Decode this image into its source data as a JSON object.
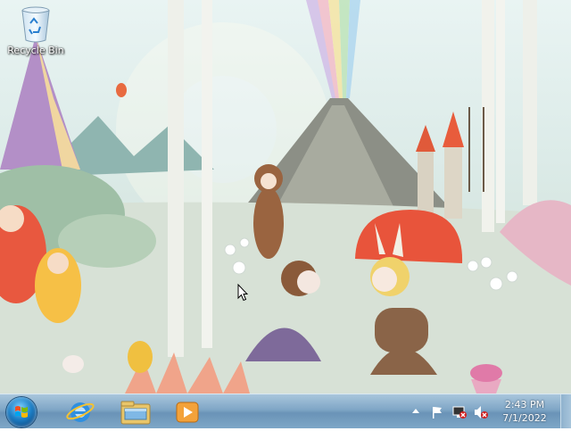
{
  "desktop": {
    "icons": [
      {
        "name": "recycle-bin",
        "label": "Recycle Bin"
      }
    ]
  },
  "taskbar": {
    "pinned": [
      {
        "name": "internet-explorer-icon"
      },
      {
        "name": "windows-explorer-icon"
      },
      {
        "name": "windows-media-player-icon"
      }
    ],
    "clock": {
      "time": "2:43 PM",
      "date": "7/1/2022"
    }
  },
  "colors": {
    "taskbar": "#7fa6c6",
    "start_orb": "#1d7fc6",
    "wallpaper_sky": "#e9f4f3"
  }
}
